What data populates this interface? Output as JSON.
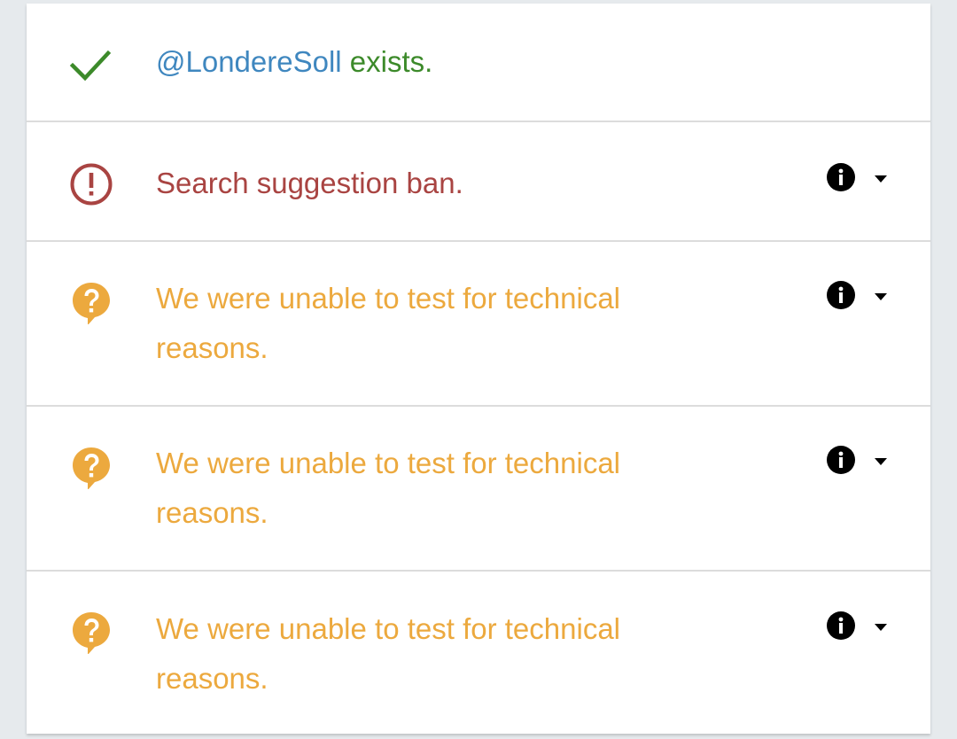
{
  "colors": {
    "handle": "#3f87bf",
    "success": "#3c8a2a",
    "ban": "#a94442",
    "warning": "#eca93e",
    "divider": "#dcdcdc",
    "background": "#e6eaed"
  },
  "results": [
    {
      "status": "success",
      "icon": "check-icon",
      "handle": "@LondereSoll",
      "text": " exists."
    },
    {
      "status": "ban",
      "icon": "exclamation-circle-icon",
      "text": "Search suggestion ban.",
      "info_icon": "info-icon",
      "expand_icon": "caret-down-icon"
    },
    {
      "status": "unknown",
      "icon": "question-bubble-icon",
      "text": "We were unable to test for technical reasons.",
      "info_icon": "info-icon",
      "expand_icon": "caret-down-icon"
    },
    {
      "status": "unknown",
      "icon": "question-bubble-icon",
      "text": "We were unable to test for technical reasons.",
      "info_icon": "info-icon",
      "expand_icon": "caret-down-icon"
    },
    {
      "status": "unknown",
      "icon": "question-bubble-icon",
      "text": "We were unable to test for technical reasons.",
      "info_icon": "info-icon",
      "expand_icon": "caret-down-icon"
    }
  ]
}
